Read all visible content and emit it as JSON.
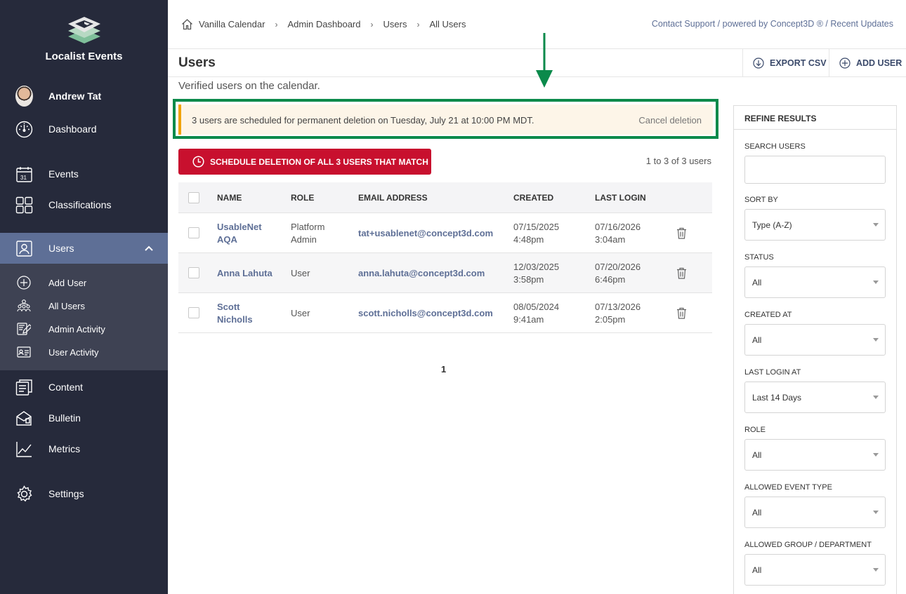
{
  "sidebar": {
    "brand_name": "Localist Events",
    "user_name": "Andrew Tat",
    "items": [
      {
        "label": "Dashboard",
        "icon": "gauge-icon"
      },
      {
        "label": "Events",
        "icon": "calendar-icon"
      },
      {
        "label": "Classifications",
        "icon": "grid-icon"
      },
      {
        "label": "Users",
        "icon": "user-card-icon"
      },
      {
        "label": "Content",
        "icon": "document-icon"
      },
      {
        "label": "Bulletin",
        "icon": "bulletin-icon"
      },
      {
        "label": "Metrics",
        "icon": "chart-icon"
      },
      {
        "label": "Settings",
        "icon": "gear-icon"
      }
    ],
    "sub_items": [
      {
        "label": "Add User",
        "icon": "plus-circle-icon"
      },
      {
        "label": "All Users",
        "icon": "org-chart-icon"
      },
      {
        "label": "Admin Activity",
        "icon": "edit-icon"
      },
      {
        "label": "User Activity",
        "icon": "id-card-icon"
      }
    ]
  },
  "breadcrumb": [
    "Vanilla Calendar",
    "Admin Dashboard",
    "Users",
    "All Users"
  ],
  "top_links": "Contact Support / powered by Concept3D ® / Recent Updates",
  "header": {
    "title": "Users",
    "export_label": "EXPORT CSV",
    "add_label": "ADD USER"
  },
  "subtitle": "Verified users on the calendar.",
  "alert": {
    "text": "3 users are scheduled for permanent deletion on Tuesday, July 21 at 10:00 PM MDT.",
    "cancel_label": "Cancel deletion"
  },
  "schedule_button": "SCHEDULE DELETION OF ALL 3 USERS THAT MATCH",
  "results_count": "1 to 3 of 3 users",
  "table": {
    "headers": [
      "NAME",
      "ROLE",
      "EMAIL ADDRESS",
      "CREATED",
      "LAST LOGIN"
    ],
    "rows": [
      {
        "name_1": "UsableNet",
        "name_2": "AQA",
        "role_1": "Platform",
        "role_2": "Admin",
        "email": "tat+usablenet@concept3d.com",
        "created_1": "07/15/2025",
        "created_2": "4:48pm",
        "last_1": "07/16/2026",
        "last_2": "3:04am"
      },
      {
        "name_1": "Anna Lahuta",
        "name_2": "",
        "role_1": "User",
        "role_2": "",
        "email": "anna.lahuta@concept3d.com",
        "created_1": "12/03/2025",
        "created_2": "3:58pm",
        "last_1": "07/20/2026",
        "last_2": "6:46pm"
      },
      {
        "name_1": "Scott",
        "name_2": "Nicholls",
        "role_1": "User",
        "role_2": "",
        "email": "scott.nicholls@concept3d.com",
        "created_1": "08/05/2024",
        "created_2": "9:41am",
        "last_1": "07/13/2026",
        "last_2": "2:05pm"
      }
    ]
  },
  "pagination": "1",
  "refine": {
    "title": "REFINE RESULTS",
    "search_label": "SEARCH USERS",
    "search_value": "",
    "filters": [
      {
        "label": "SORT BY",
        "value": "Type (A-Z)"
      },
      {
        "label": "STATUS",
        "value": "All"
      },
      {
        "label": "CREATED AT",
        "value": "All"
      },
      {
        "label": "LAST LOGIN AT",
        "value": "Last 14 Days"
      },
      {
        "label": "ROLE",
        "value": "All"
      },
      {
        "label": "ALLOWED EVENT TYPE",
        "value": "All"
      },
      {
        "label": "ALLOWED GROUP / DEPARTMENT",
        "value": "All"
      }
    ]
  },
  "colors": {
    "sidebar_bg": "#262a3b",
    "sidebar_active": "#5e6f96",
    "danger": "#c8102e",
    "link": "#5e6f96",
    "alert_bg": "#fdf5e8",
    "alert_bar": "#f0a30a",
    "highlight": "#0b8a4b"
  }
}
